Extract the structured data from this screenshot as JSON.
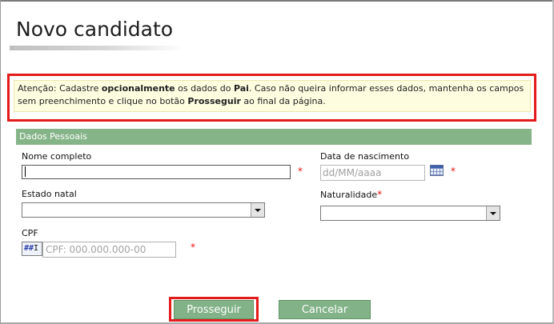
{
  "page": {
    "title": "Novo candidato"
  },
  "notice": {
    "segments": [
      {
        "text": "Atenção: Cadastre ",
        "bold": false
      },
      {
        "text": "opcionalmente",
        "bold": true
      },
      {
        "text": " os dados do ",
        "bold": false
      },
      {
        "text": "Pai",
        "bold": true
      },
      {
        "text": ". Caso não queira informar esses dados, mantenha os campos sem preenchimento e clique no botão ",
        "bold": false
      },
      {
        "text": "Prosseguir",
        "bold": true
      },
      {
        "text": " ao final da página.",
        "bold": false
      }
    ]
  },
  "section": {
    "title": "Dados Pessoais"
  },
  "fields": {
    "nome": {
      "label": "Nome completo",
      "value": "",
      "required_mark": "*"
    },
    "data_nascimento": {
      "label": "Data de nascimento",
      "placeholder": "dd/MM/aaaa",
      "required_mark": "*"
    },
    "estado_natal": {
      "label": "Estado natal",
      "value": ""
    },
    "naturalidade": {
      "label": "Naturalidade",
      "value": "",
      "required_mark": "*"
    },
    "cpf": {
      "label": "CPF",
      "placeholder": "CPF: 000.000.000-00",
      "icon_text": "##",
      "icon_cursor": "I",
      "required_mark": "*"
    }
  },
  "buttons": {
    "prosseguir": "Prosseguir",
    "cancelar": "Cancelar"
  },
  "colors": {
    "accent_green": "#86b489",
    "highlight_red": "#e31b1b",
    "notice_bg": "#fffde0"
  }
}
